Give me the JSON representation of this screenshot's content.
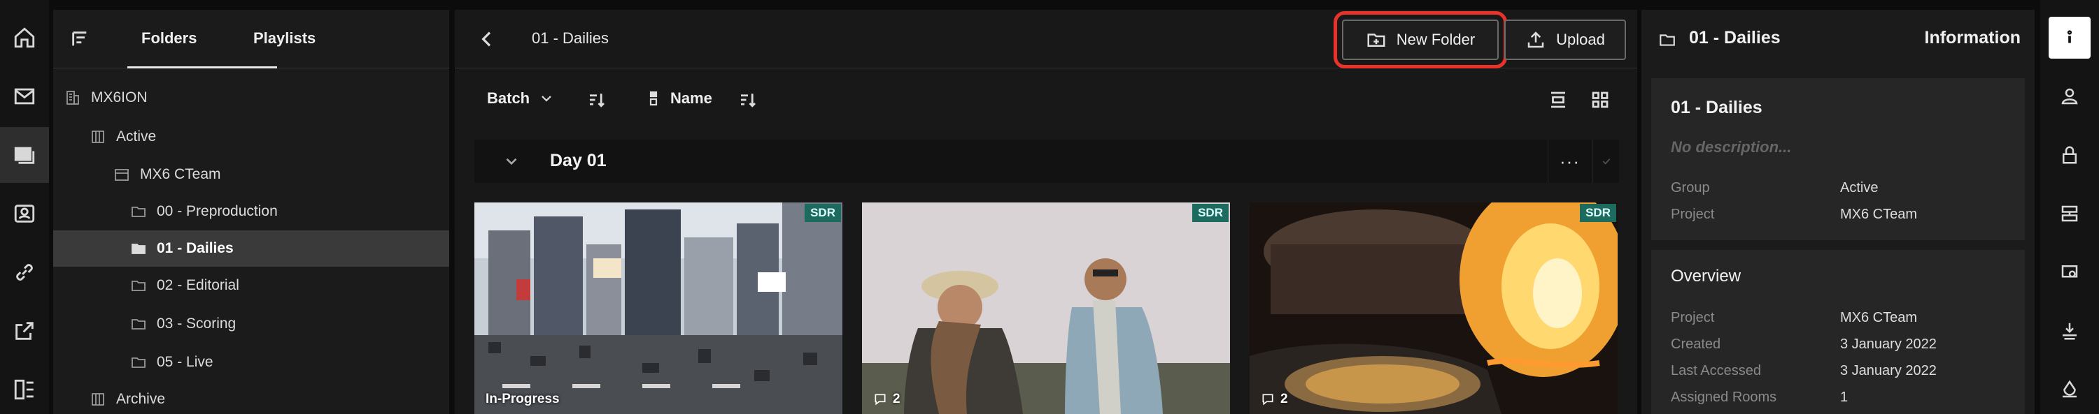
{
  "tree": {
    "tabs": [
      "Folders",
      "Playlists"
    ],
    "items": [
      {
        "label": "MX6ION",
        "level": 0,
        "icon": "building-icon"
      },
      {
        "label": "Active",
        "level": 1,
        "icon": "columns-icon"
      },
      {
        "label": "MX6 CTeam",
        "level": 2,
        "icon": "calendar-icon"
      },
      {
        "label": "00 - Preproduction",
        "level": 3,
        "icon": "folder-icon"
      },
      {
        "label": "01 - Dailies",
        "level": 3,
        "icon": "folder-filled-icon",
        "selected": true
      },
      {
        "label": "02 - Editorial",
        "level": 3,
        "icon": "folder-icon"
      },
      {
        "label": "03 - Scoring",
        "level": 3,
        "icon": "folder-icon"
      },
      {
        "label": "05 - Live",
        "level": 3,
        "icon": "folder-icon"
      },
      {
        "label": "Archive",
        "level": 1,
        "icon": "columns-icon"
      }
    ]
  },
  "main": {
    "breadcrumb": "01 - Dailies",
    "new_folder_label": "New Folder",
    "upload_label": "Upload",
    "batch_label": "Batch",
    "sort_label": "Name",
    "group_title": "Day 01",
    "group_more": "···",
    "cards": [
      {
        "badge": "SDR",
        "label": "In-Progress",
        "comments": null,
        "scene": "city"
      },
      {
        "badge": "SDR",
        "label": null,
        "comments": "2",
        "scene": "couple"
      },
      {
        "badge": "SDR",
        "label": null,
        "comments": "2",
        "scene": "fire"
      }
    ]
  },
  "info": {
    "header_name": "01 - Dailies",
    "header_tab": "Information",
    "title": "01 - Dailies",
    "description": "No description...",
    "group_key": "Group",
    "group_val": "Active",
    "project_key": "Project",
    "project_val": "MX6 CTeam",
    "overview_title": "Overview",
    "overview": [
      {
        "k": "Project",
        "v": "MX6 CTeam"
      },
      {
        "k": "Created",
        "v": "3 January 2022"
      },
      {
        "k": "Last Accessed",
        "v": "3 January 2022"
      },
      {
        "k": "Assigned Rooms",
        "v": "1"
      }
    ]
  },
  "colors": {
    "highlight": "#e8332a",
    "sdr_badge": "#1d6b5e",
    "selected_row": "#3a3a3a"
  }
}
